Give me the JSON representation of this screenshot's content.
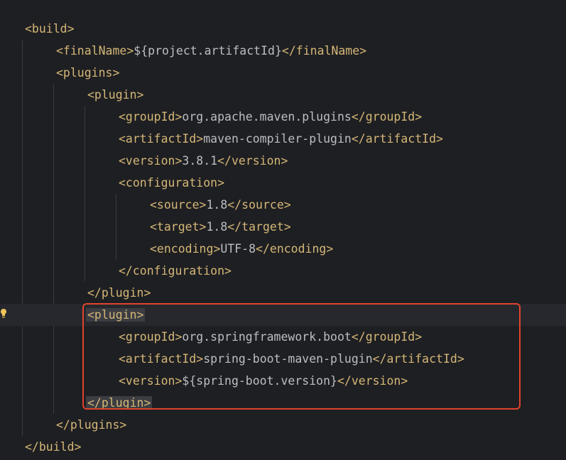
{
  "lines": [
    {
      "tag1": "<build>",
      "text": "",
      "tag2": ""
    },
    {
      "tag1": "<finalName>",
      "text": "${project.artifactId}",
      "tag2": "</finalName>"
    },
    {
      "tag1": "<plugins>",
      "text": "",
      "tag2": ""
    },
    {
      "tag1": "<plugin>",
      "text": "",
      "tag2": ""
    },
    {
      "tag1": "<groupId>",
      "text": "org.apache.maven.plugins",
      "tag2": "</groupId>"
    },
    {
      "tag1": "<artifactId>",
      "text": "maven-compiler-plugin",
      "tag2": "</artifactId>"
    },
    {
      "tag1": "<version>",
      "text": "3.8.1",
      "tag2": "</version>"
    },
    {
      "tag1": "<configuration>",
      "text": "",
      "tag2": ""
    },
    {
      "tag1": "<source>",
      "text": "1.8",
      "tag2": "</source>"
    },
    {
      "tag1": "<target>",
      "text": "1.8",
      "tag2": "</target>"
    },
    {
      "tag1": "<encoding>",
      "text": "UTF-8",
      "tag2": "</encoding>"
    },
    {
      "tag1": "</configuration>",
      "text": "",
      "tag2": ""
    },
    {
      "tag1": "</plugin>",
      "text": "",
      "tag2": ""
    },
    {
      "tag1": "<plugin>",
      "text": "",
      "tag2": ""
    },
    {
      "tag1": "<groupId>",
      "text": "org.springframework.boot",
      "tag2": "</groupId>"
    },
    {
      "tag1": "<artifactId>",
      "text": "spring-boot-maven-plugin",
      "tag2": "</artifactId>"
    },
    {
      "tag1": "<version>",
      "text": "${spring-boot.version}",
      "tag2": "</version>"
    },
    {
      "tag1": "</plugin>",
      "text": "",
      "tag2": ""
    },
    {
      "tag1": "</plugins>",
      "text": "",
      "tag2": ""
    },
    {
      "tag1": "</build>",
      "text": "",
      "tag2": ""
    }
  ],
  "colors": {
    "tag": "#d5b778",
    "text": "#bcbec4",
    "background": "#1e1f22",
    "annotation_box": "#e0442c"
  },
  "icons": {
    "gutter": "intention-bulb-icon"
  }
}
